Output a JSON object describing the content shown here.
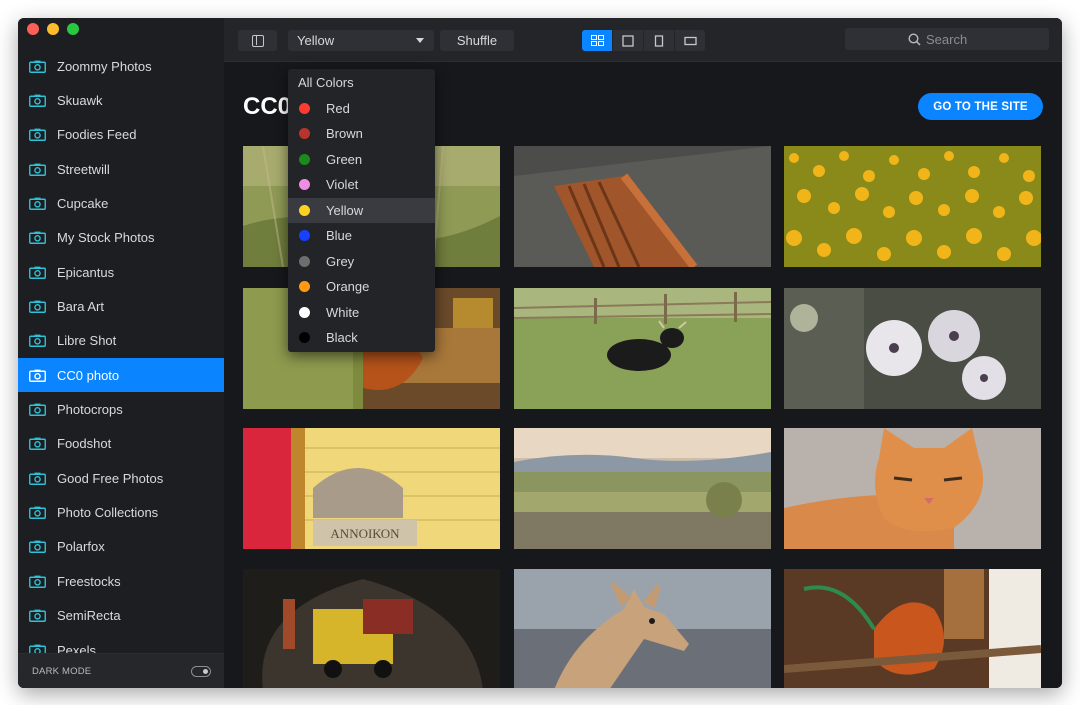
{
  "sidebar": {
    "items": [
      {
        "label": "Zoommy Photos"
      },
      {
        "label": "Skuawk"
      },
      {
        "label": "Foodies Feed"
      },
      {
        "label": "Streetwill"
      },
      {
        "label": "Cupcake"
      },
      {
        "label": "My Stock Photos"
      },
      {
        "label": "Epicantus"
      },
      {
        "label": "Bara Art"
      },
      {
        "label": "Libre Shot"
      },
      {
        "label": "CC0 photo",
        "active": true
      },
      {
        "label": "Photocrops"
      },
      {
        "label": "Foodshot"
      },
      {
        "label": "Good Free Photos"
      },
      {
        "label": "Photo Collections"
      },
      {
        "label": "Polarfox"
      },
      {
        "label": "Freestocks"
      },
      {
        "label": "SemiRecta"
      },
      {
        "label": "Pexels"
      }
    ],
    "dark_mode_label": "DARK MODE",
    "dark_mode_on": true,
    "icon": "camera-icon"
  },
  "toolbar": {
    "color_selected": "Yellow",
    "shuffle_label": "Shuffle",
    "search_placeholder": "Search",
    "active_view": "grid"
  },
  "dropdown": {
    "items": [
      {
        "label": "All Colors",
        "color": null
      },
      {
        "label": "Red",
        "color": "#ff3b2f"
      },
      {
        "label": "Brown",
        "color": "#b8342c"
      },
      {
        "label": "Green",
        "color": "#1e8a1e"
      },
      {
        "label": "Violet",
        "color": "#f08ce6"
      },
      {
        "label": "Yellow",
        "color": "#ffd21f",
        "selected": true
      },
      {
        "label": "Blue",
        "color": "#1740ff"
      },
      {
        "label": "Grey",
        "color": "#6e6e6e"
      },
      {
        "label": "Orange",
        "color": "#ff9a12"
      },
      {
        "label": "White",
        "color": "#ffffff"
      },
      {
        "label": "Black",
        "color": "#000000"
      }
    ]
  },
  "main": {
    "title": "CC0 photo",
    "cta_label": "GO TO THE SITE",
    "photos": [
      {
        "subject": "grass-meadow"
      },
      {
        "subject": "wooden-boat"
      },
      {
        "subject": "yellow-flowers"
      },
      {
        "subject": "squirrel-feeder"
      },
      {
        "subject": "cow-in-field"
      },
      {
        "subject": "white-seed-heads"
      },
      {
        "subject": "yellow-wall-sign",
        "sign_text": "ΑΝΝΟΙΚΟΝ"
      },
      {
        "subject": "landscape-plain"
      },
      {
        "subject": "ginger-cat"
      },
      {
        "subject": "mine-tunnel"
      },
      {
        "subject": "deer-fawn"
      },
      {
        "subject": "squirrel-red"
      }
    ]
  },
  "colors": {
    "accent": "#0a84ff",
    "window_bg": "#1a1b1e",
    "sidebar_bg": "#1d1e21",
    "toolbar_bg": "#242529"
  }
}
